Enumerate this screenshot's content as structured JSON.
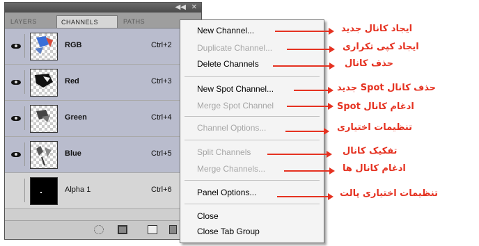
{
  "panel": {
    "tabs": [
      {
        "label": "LAYERS"
      },
      {
        "label": "CHANNELS"
      },
      {
        "label": "PATHS"
      }
    ],
    "menu_button_icon": "panel-menu-icon",
    "collapse_icon": "double-arrow-icon",
    "close_icon": "close-icon",
    "channels": [
      {
        "name": "RGB",
        "shortcut": "Ctrl+2",
        "visible": true
      },
      {
        "name": "Red",
        "shortcut": "Ctrl+3",
        "visible": true
      },
      {
        "name": "Green",
        "shortcut": "Ctrl+4",
        "visible": true
      },
      {
        "name": "Blue",
        "shortcut": "Ctrl+5",
        "visible": true
      },
      {
        "name": "Alpha 1",
        "shortcut": "Ctrl+6",
        "visible": false
      }
    ],
    "bottom_icons": [
      "load-selection-icon",
      "save-selection-icon",
      "new-channel-icon",
      "trash-icon"
    ]
  },
  "menu": {
    "items": [
      {
        "label": "New Channel...",
        "enabled": true
      },
      {
        "label": "Duplicate Channel...",
        "enabled": false
      },
      {
        "label": "Delete Channels",
        "enabled": true
      },
      {
        "label": "New Spot Channel...",
        "enabled": true
      },
      {
        "label": "Merge Spot Channel",
        "enabled": false
      },
      {
        "label": "Channel Options...",
        "enabled": false
      },
      {
        "label": "Split Channels",
        "enabled": false
      },
      {
        "label": "Merge Channels...",
        "enabled": false
      },
      {
        "label": "Panel Options...",
        "enabled": true
      },
      {
        "label": "Close",
        "enabled": true
      },
      {
        "label": "Close Tab Group",
        "enabled": true
      }
    ]
  },
  "annotations": [
    {
      "text": "ایجاد کانال جدید"
    },
    {
      "text": "ایجاد کپی تکراری"
    },
    {
      "text": "حذف کانال"
    },
    {
      "text": "حذف کانال Spot جدید"
    },
    {
      "text": "ادغام کانال Spot"
    },
    {
      "text": "تنظیمات اختیاری"
    },
    {
      "text": "تفکیک کانال"
    },
    {
      "text": "ادغام کانال ها"
    },
    {
      "text": "تنظیمات اختیاری پالت"
    }
  ],
  "colors": {
    "annotation": "#e53221",
    "selected_row": "#b9bccd",
    "menu_bg": "#f4f4f4"
  }
}
